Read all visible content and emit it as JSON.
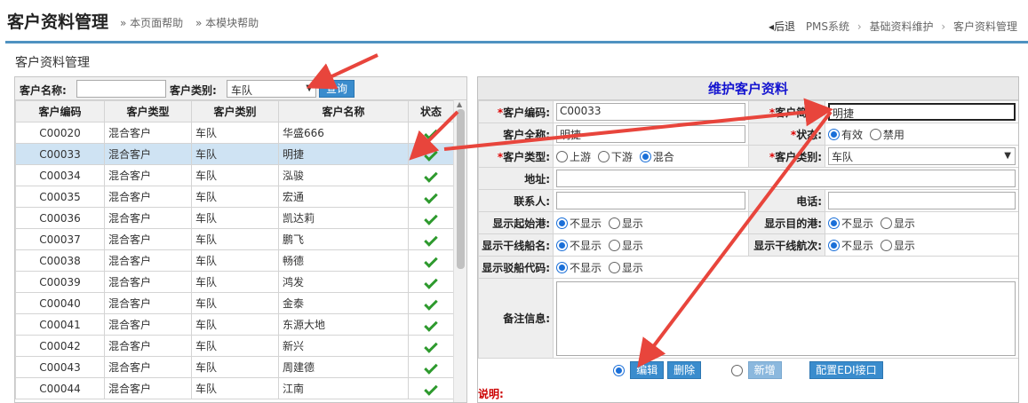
{
  "header": {
    "title": "客户资料管理",
    "help_page": "» 本页面帮助",
    "help_module": "» 本模块帮助",
    "back": "◂后退",
    "crumbs": [
      "PMS系统",
      "基础资料维护",
      "客户资料管理"
    ]
  },
  "section_title": "客户资料管理",
  "search": {
    "name_label": "客户名称:",
    "name_value": "",
    "type_label": "客户类别:",
    "type_value": "车队",
    "query_label": "查询"
  },
  "table": {
    "columns": [
      "客户编码",
      "客户类型",
      "客户类别",
      "客户名称",
      "状态"
    ],
    "rows": [
      {
        "code": "C00020",
        "kind": "混合客户",
        "category": "车队",
        "name": "华盛666"
      },
      {
        "code": "C00033",
        "kind": "混合客户",
        "category": "车队",
        "name": "明捷"
      },
      {
        "code": "C00034",
        "kind": "混合客户",
        "category": "车队",
        "name": "泓骏"
      },
      {
        "code": "C00035",
        "kind": "混合客户",
        "category": "车队",
        "name": "宏通"
      },
      {
        "code": "C00036",
        "kind": "混合客户",
        "category": "车队",
        "name": "凯达莉"
      },
      {
        "code": "C00037",
        "kind": "混合客户",
        "category": "车队",
        "name": "鹏飞"
      },
      {
        "code": "C00038",
        "kind": "混合客户",
        "category": "车队",
        "name": "畅德"
      },
      {
        "code": "C00039",
        "kind": "混合客户",
        "category": "车队",
        "name": "鸿发"
      },
      {
        "code": "C00040",
        "kind": "混合客户",
        "category": "车队",
        "name": "金泰"
      },
      {
        "code": "C00041",
        "kind": "混合客户",
        "category": "车队",
        "name": "东源大地"
      },
      {
        "code": "C00042",
        "kind": "混合客户",
        "category": "车队",
        "name": "新兴"
      },
      {
        "code": "C00043",
        "kind": "混合客户",
        "category": "车队",
        "name": "周建德"
      },
      {
        "code": "C00044",
        "kind": "混合客户",
        "category": "车队",
        "name": "江南"
      }
    ],
    "selected_row": 1
  },
  "form": {
    "title": "维护客户资料",
    "required_mark": "*",
    "code_label": "客户编码:",
    "code_value": "C00033",
    "short_label": "客户简称:",
    "short_value": "明捷",
    "full_label": "客户全称:",
    "full_value": "明捷",
    "status_label": "状态:",
    "status_opts": [
      "有效",
      "禁用"
    ],
    "kind_label": "客户类型:",
    "kind_opts": [
      "上游",
      "下游",
      "混合"
    ],
    "category_label": "客户类别:",
    "category_value": "车队",
    "address_label": "地址:",
    "contact_label": "联系人:",
    "phone_label": "电话:",
    "start_port_label": "显示起始港:",
    "dest_port_label": "显示目的港:",
    "ship_name_label": "显示干线船名:",
    "voyage_label": "显示干线航次:",
    "barge_label": "显示驳船代码:",
    "show_opts": [
      "不显示",
      "显示"
    ],
    "remark_label": "备注信息:"
  },
  "actions": {
    "edit": "编辑",
    "delete": "删除",
    "add": "新增",
    "edi": "配置EDI接口"
  },
  "note_label": "说明:",
  "colors": {
    "accent": "#3a8ccd",
    "title_blue": "#1515d0",
    "arrow_red": "#e8453c"
  }
}
